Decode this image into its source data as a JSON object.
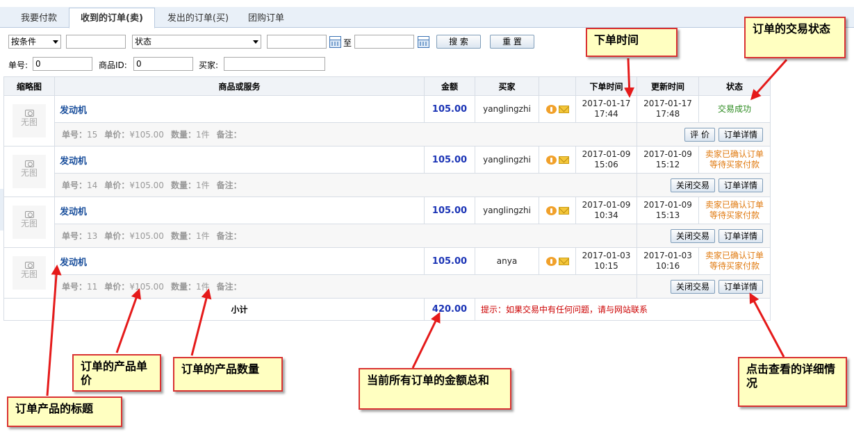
{
  "tabs": [
    {
      "label": "我要付款",
      "active": false
    },
    {
      "label": "收到的订单(卖)",
      "active": true
    },
    {
      "label": "发出的订单(买)",
      "active": false
    },
    {
      "label": "团购订单",
      "active": false
    }
  ],
  "filters": {
    "condition_select": "按条件",
    "condition_input": "",
    "status_select": "状态",
    "date_from": "",
    "to_label": "至",
    "date_to": "",
    "search_button": "搜 索",
    "reset_button": "重 置",
    "order_no_label": "单号:",
    "order_no_value": "0",
    "product_id_label": "商品ID:",
    "product_id_value": "0",
    "buyer_label": "买家:",
    "buyer_value": ""
  },
  "table": {
    "headers": [
      "缩略图",
      "商品或服务",
      "金额",
      "买家",
      "",
      "下单时间",
      "更新时间",
      "状态"
    ],
    "no_image_text": "无图",
    "labels": {
      "order_no": "单号：",
      "unit_price": "单价：",
      "quantity": "数量：",
      "remark": "备注："
    },
    "rows": [
      {
        "title": "发动机",
        "amount": "105.00",
        "buyer": "yanglingzhi",
        "order_date": "2017-01-17",
        "order_time": "17:44",
        "update_date": "2017-01-17",
        "update_time": "17:48",
        "status_line1": "交易成功",
        "status_line2": "",
        "order_no": "15",
        "unit_price": "¥105.00",
        "quantity": "1件",
        "action1": "评 价",
        "action2": "订单详情"
      },
      {
        "title": "发动机",
        "amount": "105.00",
        "buyer": "yanglingzhi",
        "order_date": "2017-01-09",
        "order_time": "15:06",
        "update_date": "2017-01-09",
        "update_time": "15:12",
        "status_line1": "卖家已确认订单",
        "status_line2": "等待买家付款",
        "order_no": "14",
        "unit_price": "¥105.00",
        "quantity": "1件",
        "action1": "关闭交易",
        "action2": "订单详情"
      },
      {
        "title": "发动机",
        "amount": "105.00",
        "buyer": "yanglingzhi",
        "order_date": "2017-01-09",
        "order_time": "10:34",
        "update_date": "2017-01-09",
        "update_time": "15:13",
        "status_line1": "卖家已确认订单",
        "status_line2": "等待买家付款",
        "order_no": "13",
        "unit_price": "¥105.00",
        "quantity": "1件",
        "action1": "关闭交易",
        "action2": "订单详情"
      },
      {
        "title": "发动机",
        "amount": "105.00",
        "buyer": "anya",
        "order_date": "2017-01-03",
        "order_time": "10:15",
        "update_date": "2017-01-03",
        "update_time": "10:16",
        "status_line1": "卖家已确认订单",
        "status_line2": "等待买家付款",
        "order_no": "11",
        "unit_price": "¥105.00",
        "quantity": "1件",
        "action1": "关闭交易",
        "action2": "订单详情"
      }
    ],
    "subtotal_label": "小计",
    "subtotal_amount": "420.00",
    "tip": "提示：如果交易中有任何问题，请与网站联系"
  },
  "annotations": {
    "order_time": "下单时间",
    "trade_status": "订单的交易状态",
    "unit_price": "订单的产品单价",
    "quantity": "订单的产品数量",
    "total": "当前所有订单的金额总和",
    "detail": "点击查看的详细情况",
    "title": "订单产品的标题"
  },
  "colors": {
    "accent_blue": "#1a33b5",
    "status_success": "#2b8a1f",
    "status_pending": "#e07a10",
    "annotation_border": "#d93131",
    "annotation_fill": "#ffffc1"
  },
  "icons": {
    "thumbnail": "camera-icon",
    "chat": "qq-chat-icon",
    "message": "mail-icon",
    "date_picker": "calendar-icon"
  }
}
